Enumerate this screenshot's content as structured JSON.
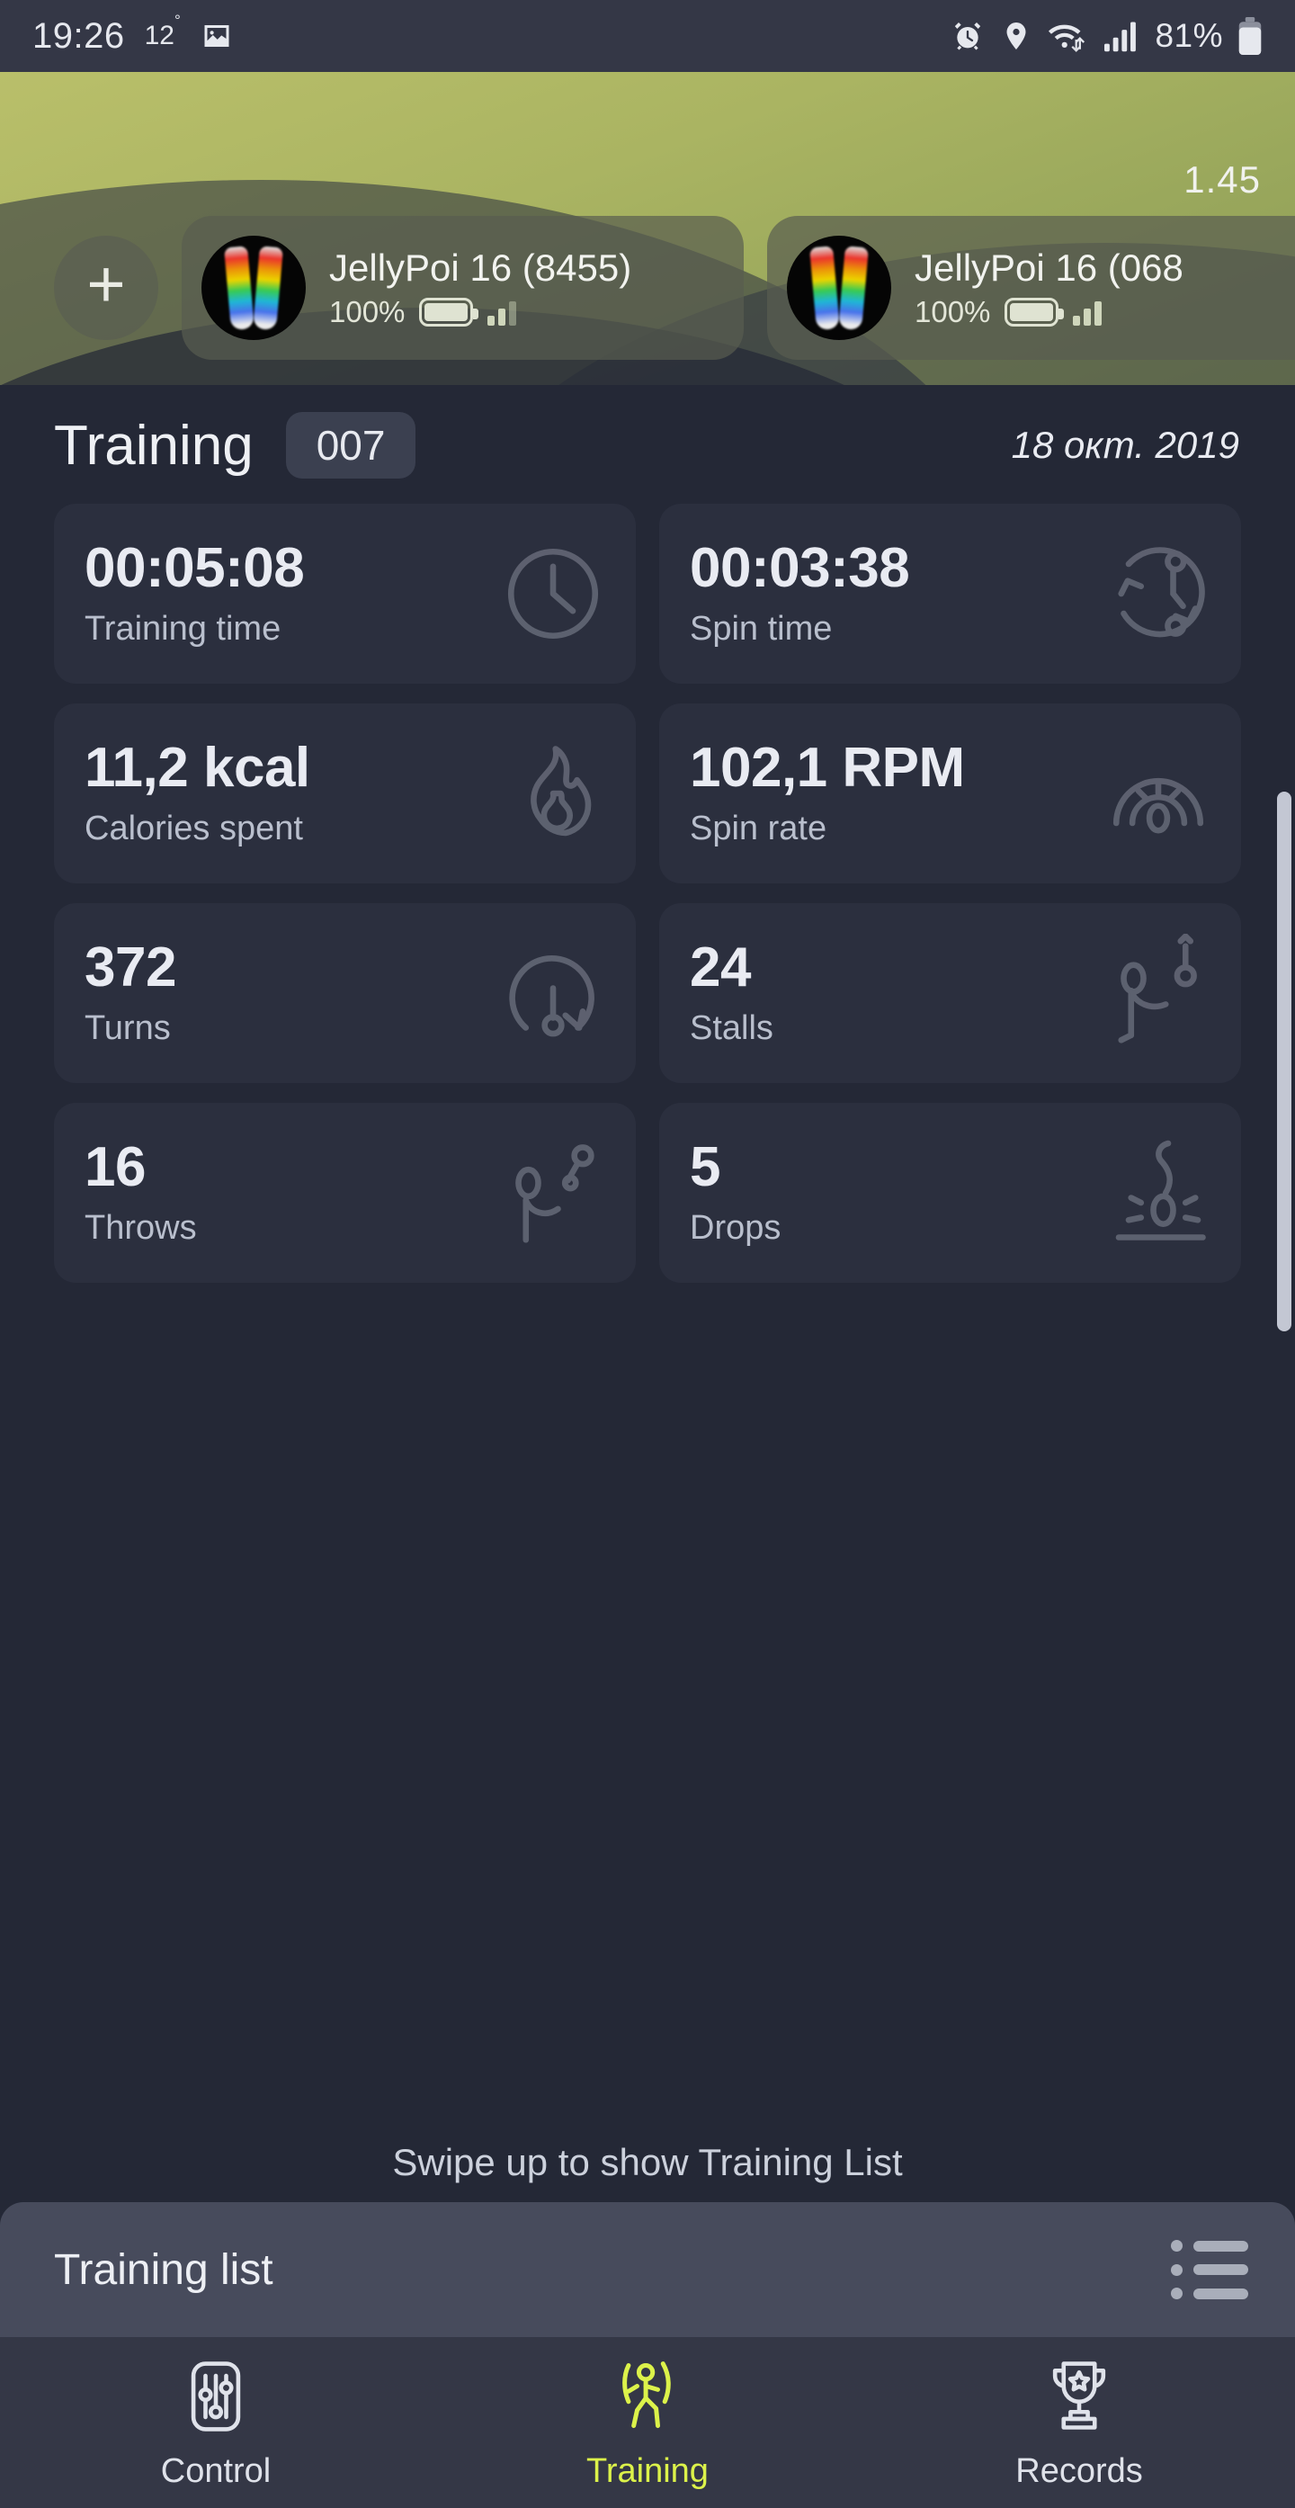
{
  "statusbar": {
    "time": "19:26",
    "temperature": "12",
    "degree": "°",
    "battery_percent": "81%",
    "icons": [
      "image-icon",
      "alarm-icon",
      "location-icon",
      "wifi-icon",
      "signal-icon",
      "battery-icon"
    ]
  },
  "header": {
    "version": "1.45",
    "add_button_label": "+",
    "devices": [
      {
        "name": "JellyPoi 16 (8455)",
        "battery": "100%"
      },
      {
        "name": "JellyPoi 16 (068",
        "battery": "100%"
      }
    ]
  },
  "main": {
    "title": "Training",
    "number_badge": "007",
    "date": "18 окт. 2019",
    "stats": [
      {
        "value": "00:05:08",
        "label": "Training time",
        "icon": "clock-icon"
      },
      {
        "value": "00:03:38",
        "label": "Spin time",
        "icon": "spin-time-icon"
      },
      {
        "value": "11,2",
        "unit": "kcal",
        "label": "Calories spent",
        "icon": "flame-icon"
      },
      {
        "value": "102,1",
        "unit": "RPM",
        "label": "Spin rate",
        "icon": "gauge-icon"
      },
      {
        "value": "372",
        "unit": "",
        "label": "Turns",
        "icon": "turns-icon"
      },
      {
        "value": "24",
        "unit": "",
        "label": "Stalls",
        "icon": "stalls-icon"
      },
      {
        "value": "16",
        "unit": "",
        "label": "Throws",
        "icon": "throws-icon"
      },
      {
        "value": "5",
        "unit": "",
        "label": "Drops",
        "icon": "drops-icon"
      }
    ]
  },
  "sheet": {
    "swipe_hint": "Swipe up to show Training List",
    "title": "Training list",
    "list_icon": "list-icon"
  },
  "bottomnav": {
    "items": [
      {
        "label": "Control",
        "icon": "sliders-icon",
        "active": false
      },
      {
        "label": "Training",
        "icon": "runner-icon",
        "active": true
      },
      {
        "label": "Records",
        "icon": "trophy-icon",
        "active": false
      }
    ]
  },
  "colors": {
    "background": "#242836",
    "card": "#2b2f3e",
    "accent": "#dcf24a",
    "olive": "#aab462",
    "sheet": "#474b5c",
    "statusbar": "#343746"
  }
}
